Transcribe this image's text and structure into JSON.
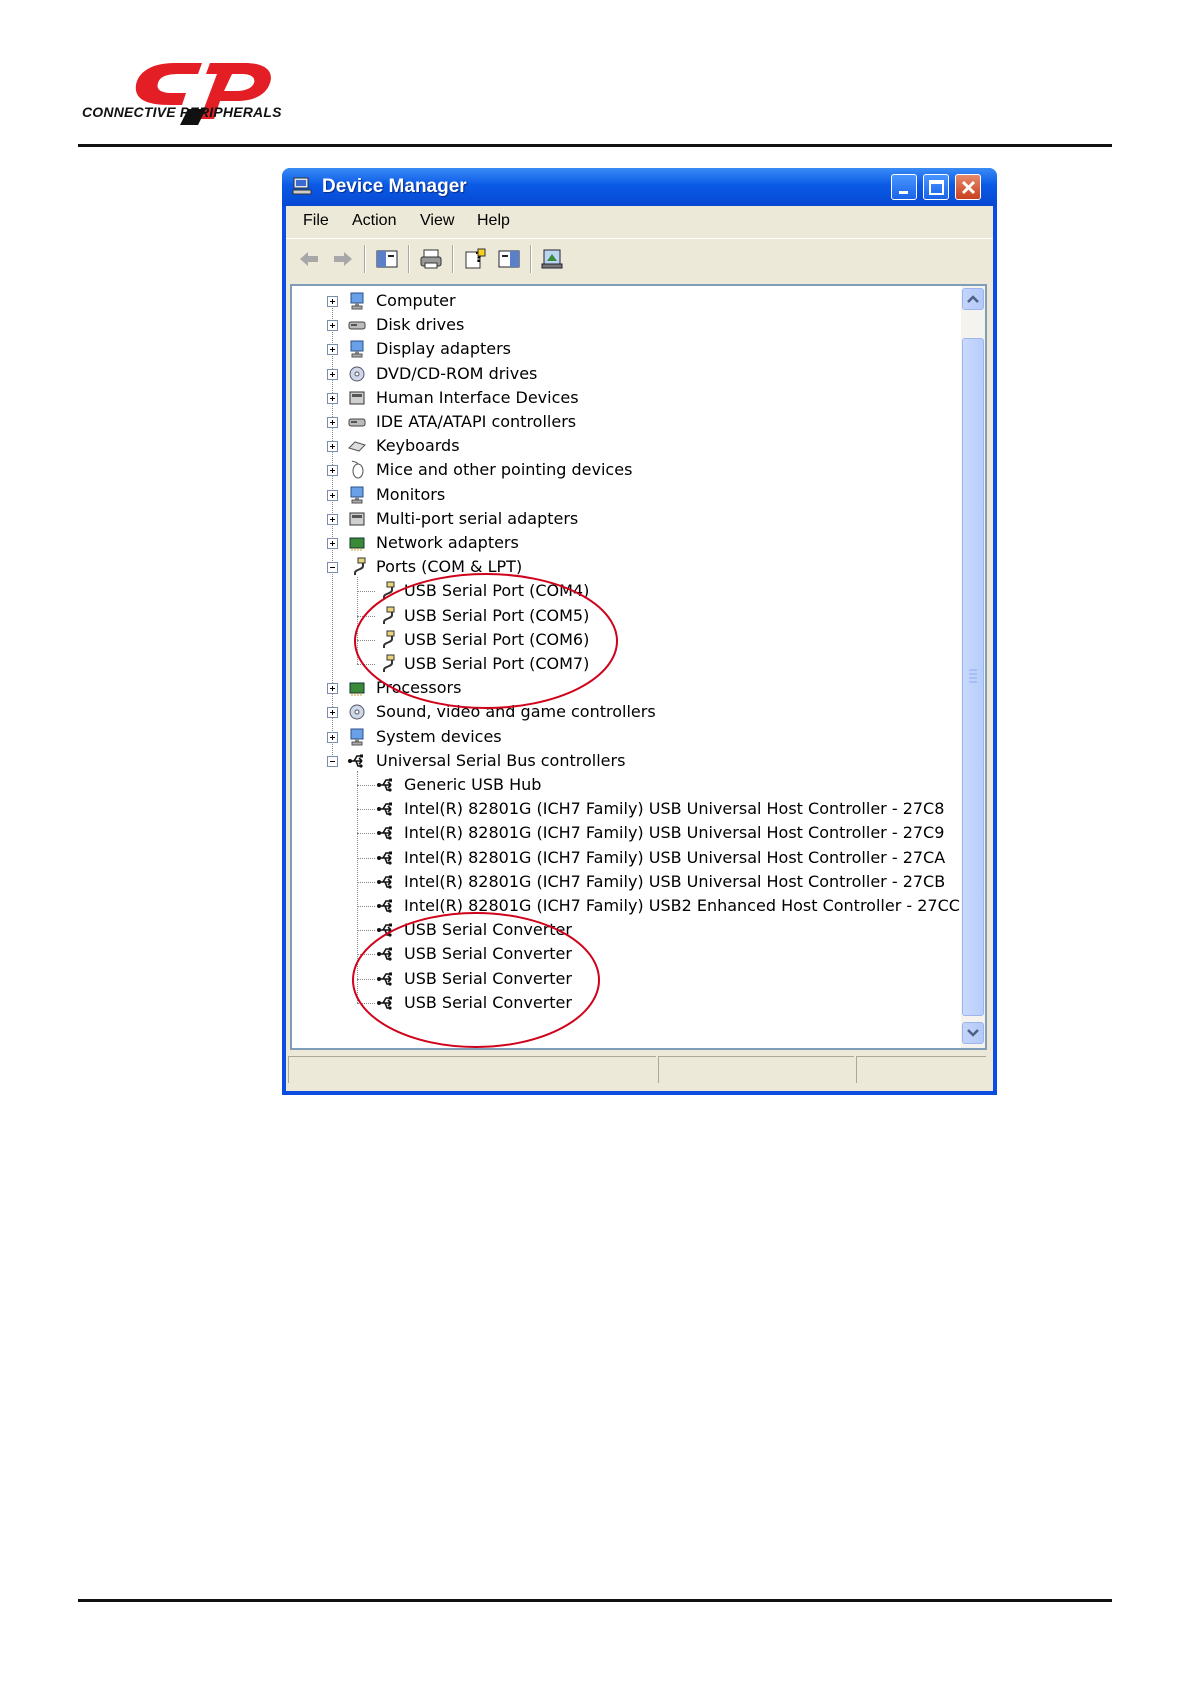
{
  "logo": {
    "text": "CONNECTIVE PERIPHERALS",
    "brand_color": "#e31e24"
  },
  "window": {
    "title": "Device Manager",
    "title_icon": "computer-icon",
    "controls": [
      "minimize-icon",
      "maximize-icon",
      "close-icon"
    ]
  },
  "menu": [
    "File",
    "Action",
    "View",
    "Help"
  ],
  "toolbar": [
    "back-arrow-icon",
    "forward-arrow-icon",
    "show-hide-tree-icon",
    "print-icon",
    "properties-help-icon",
    "view-pane-icon",
    "scan-hardware-icon"
  ],
  "tree": {
    "items": [
      {
        "label": "Computer",
        "icon": "computer-icon",
        "expanded": false
      },
      {
        "label": "Disk drives",
        "icon": "disk-drive-icon",
        "expanded": false
      },
      {
        "label": "Display adapters",
        "icon": "display-adapter-icon",
        "expanded": false
      },
      {
        "label": "DVD/CD-ROM drives",
        "icon": "cdrom-icon",
        "expanded": false
      },
      {
        "label": "Human Interface Devices",
        "icon": "hid-icon",
        "expanded": false
      },
      {
        "label": "IDE ATA/ATAPI controllers",
        "icon": "ide-controller-icon",
        "expanded": false
      },
      {
        "label": "Keyboards",
        "icon": "keyboard-icon",
        "expanded": false
      },
      {
        "label": "Mice and other pointing devices",
        "icon": "mouse-icon",
        "expanded": false
      },
      {
        "label": "Monitors",
        "icon": "monitor-icon",
        "expanded": false
      },
      {
        "label": "Multi-port serial adapters",
        "icon": "multiport-serial-icon",
        "expanded": false
      },
      {
        "label": "Network adapters",
        "icon": "network-adapter-icon",
        "expanded": false
      },
      {
        "label": "Ports (COM & LPT)",
        "icon": "port-connector-icon",
        "expanded": true,
        "children": [
          "USB Serial Port (COM4)",
          "USB Serial Port (COM5)",
          "USB Serial Port (COM6)",
          "USB Serial Port (COM7)"
        ]
      },
      {
        "label": "Processors",
        "icon": "processor-icon",
        "expanded": false
      },
      {
        "label": "Sound, video and game controllers",
        "icon": "sound-icon",
        "expanded": false
      },
      {
        "label": "System devices",
        "icon": "system-device-icon",
        "expanded": false
      },
      {
        "label": "Universal Serial Bus controllers",
        "icon": "usb-icon",
        "expanded": true,
        "children": [
          "Generic USB Hub",
          "Intel(R) 82801G (ICH7 Family) USB Universal Host Controller - 27C8",
          "Intel(R) 82801G (ICH7 Family) USB Universal Host Controller - 27C9",
          "Intel(R) 82801G (ICH7 Family) USB Universal Host Controller - 27CA",
          "Intel(R) 82801G (ICH7 Family) USB Universal Host Controller - 27CB",
          "Intel(R) 82801G (ICH7 Family) USB2 Enhanced Host Controller - 27CC",
          "USB Serial Converter",
          "USB Serial Converter",
          "USB Serial Converter",
          "USB Serial Converter"
        ]
      }
    ]
  },
  "annotation_color": "#d0021b"
}
